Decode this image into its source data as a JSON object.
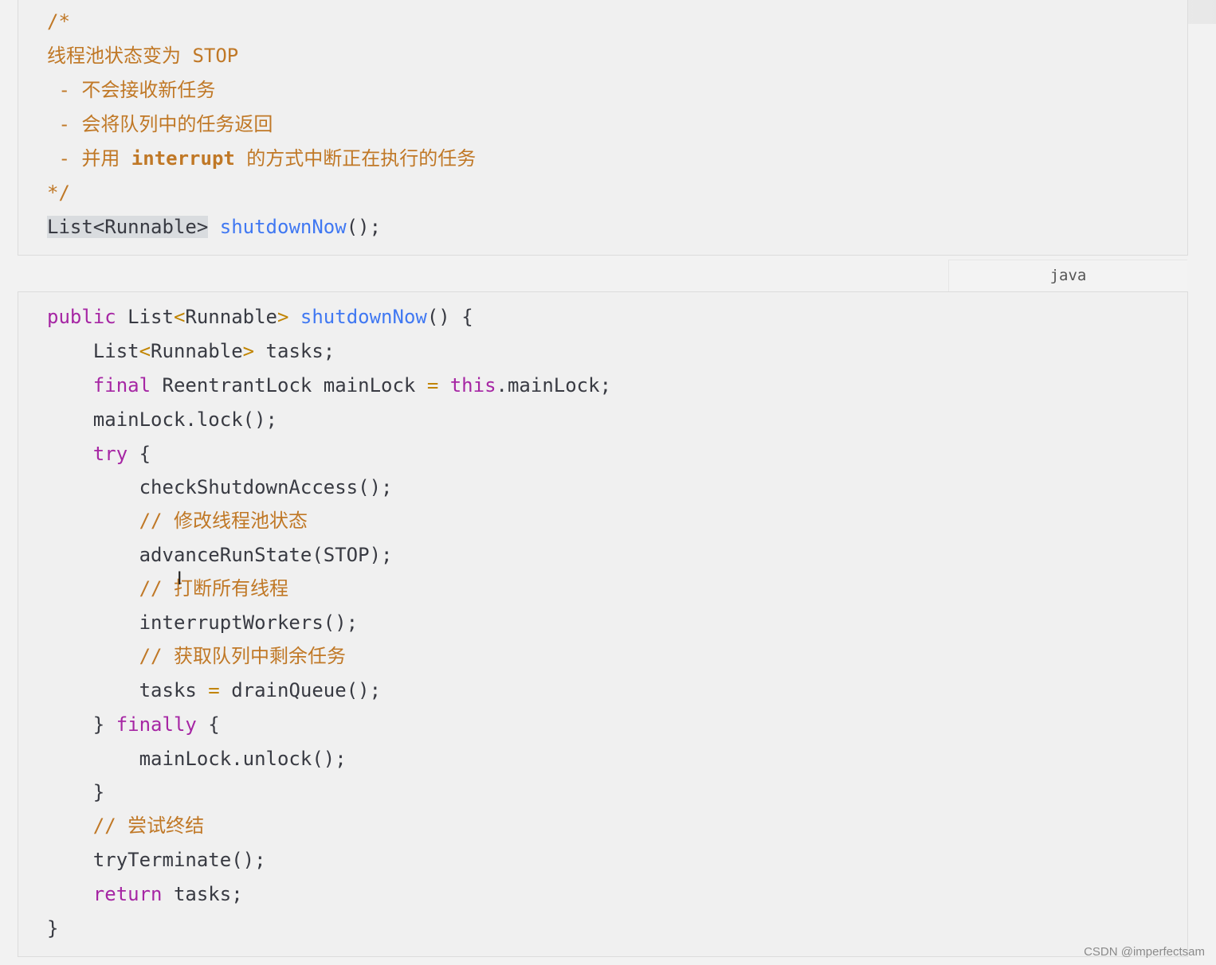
{
  "block1": {
    "lines": {
      "l1": "/*",
      "l2": "线程池状态变为 STOP",
      "l3a": " - 不会接收新任务",
      "l4a": " - 会将队列中的任务返回",
      "l5a": " - 并用 ",
      "l5b": "interrupt",
      "l5c": " 的方式中断正在执行的任务",
      "l6": "*/",
      "l7a": "List<Runnable>",
      "l7b": " ",
      "l7c": "shutdownNow",
      "l7d": "();"
    }
  },
  "lang_tab": {
    "label": "java"
  },
  "block2": {
    "lines": {
      "p1_kw": "public",
      "p1_a": " List",
      "p1_lt": "<",
      "p1_b": "Runnable",
      "p1_gt": ">",
      "p1_c": " ",
      "p1_fn": "shutdownNow",
      "p1_d": "() {",
      "p2_a": "    List",
      "p2_lt": "<",
      "p2_b": "Runnable",
      "p2_gt": ">",
      "p2_c": " tasks;",
      "p3_kw": "    final",
      "p3_a": " ReentrantLock mainLock ",
      "p3_eq": "=",
      "p3_b": " ",
      "p3_this": "this",
      "p3_c": ".mainLock;",
      "p4": "    mainLock.lock();",
      "p5_kw": "    try",
      "p5_a": " {",
      "p6": "        checkShutdownAccess();",
      "p7": "        // 修改线程池状态",
      "p8": "        advanceRunState(STOP);",
      "p9": "        // 打断所有线程",
      "p10": "        interruptWorkers();",
      "p11": "        // 获取队列中剩余任务",
      "p12_a": "        tasks ",
      "p12_eq": "=",
      "p12_b": " drainQueue();",
      "p13_a": "    } ",
      "p13_kw": "finally",
      "p13_b": " {",
      "p14": "        mainLock.unlock();",
      "p15": "    }",
      "p16": "    // 尝试终结",
      "p17": "    tryTerminate();",
      "p18_kw": "    return",
      "p18_a": " tasks;",
      "p19": "}"
    }
  },
  "watermark": "CSDN @imperfectsam",
  "colors": {
    "comment": "#c07826",
    "keyword": "#a626a4",
    "function": "#4078f2",
    "text": "#383a42"
  }
}
